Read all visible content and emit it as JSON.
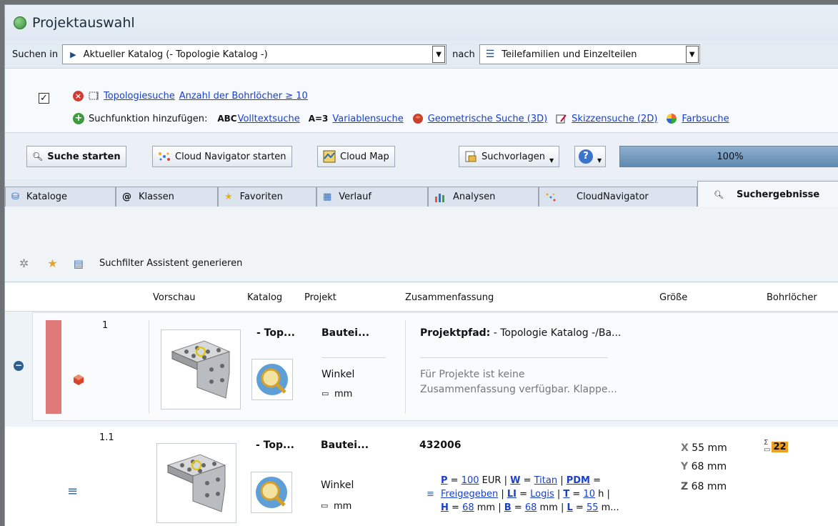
{
  "window": {
    "title": "Projektauswahl"
  },
  "search": {
    "search_in_label": "Suchen in",
    "catalog_value": "Aktueller Katalog (- Topologie Katalog -)",
    "nach_label": "nach",
    "type_value": "Teilefamilien und Einzelteilen"
  },
  "filter": {
    "topology_link": "Topologiesuche",
    "condition_link": "Anzahl der Bohrlöcher ≥ 10",
    "add_label": "Suchfunktion hinzufügen:",
    "options": [
      {
        "prefix": "ABC",
        "label": "Volltextsuche"
      },
      {
        "prefix": "A=3",
        "label": "Variablensuche"
      },
      {
        "prefix": "",
        "label": "Geometrische Suche (3D)"
      },
      {
        "prefix": "",
        "label": "Skizzensuche (2D)"
      },
      {
        "prefix": "",
        "label": "Farbsuche"
      }
    ]
  },
  "toolbar": {
    "start_search": "Suche starten",
    "cloud_navigator": "Cloud Navigator starten",
    "cloud_map": "Cloud Map",
    "templates": "Suchvorlagen",
    "progress_text": "100%",
    "progress": 1.0
  },
  "tabs": [
    {
      "label": "Kataloge",
      "icon": "catalogs-icon"
    },
    {
      "label": "Klassen",
      "icon": "at-icon"
    },
    {
      "label": "Favoriten",
      "icon": "star-icon"
    },
    {
      "label": "Verlauf",
      "icon": "calendar-icon"
    },
    {
      "label": "Analysen",
      "icon": "bar-chart-icon"
    },
    {
      "label": "CloudNavigator",
      "icon": "cloud-icon"
    },
    {
      "label": "Suchergebnisse",
      "icon": "search-icon",
      "active": true
    }
  ],
  "filterbar": {
    "wizard_label": "Suchfilter Assistent generieren"
  },
  "columns": {
    "vorschau": "Vorschau",
    "katalog": "Katalog",
    "projekt": "Projekt",
    "zusammenfassung": "Zusammenfassung",
    "groesse": "Größe",
    "bohrloecher": "Bohrlöcher"
  },
  "rows": [
    {
      "index": "1",
      "catalog": "- Top...",
      "project": "Bautei...",
      "project_sub": "Winkel",
      "unit": "mm",
      "summary_title_label": "Projektpfad:",
      "summary_title_value": " - Topologie Katalog -/Ba...",
      "summary_line1": "Für Projekte ist keine",
      "summary_line2": "Zusammenfassung verfügbar. Klappe..."
    },
    {
      "index": "1.1",
      "catalog": "- Top...",
      "project": "Bautei...",
      "project_sub": "Winkel",
      "unit": "mm",
      "summary_title": "432006",
      "summary_l1": {
        "p_key": "P",
        "p_val": "100",
        "p_unit": "EUR",
        "w_key": "W",
        "w_val": "Titan",
        "pdm_key": "PDM"
      },
      "summary_l2": {
        "pdm_val": "Freigegeben",
        "li_key": "LI",
        "li_val": "Logis",
        "t_key": "T",
        "t_val": "10",
        "t_unit": "h"
      },
      "summary_l3": {
        "h_key": "H",
        "h_val": "68",
        "b_key": "B",
        "b_val": "68",
        "l_key": "L",
        "l_val": "55",
        "tail": "m..."
      },
      "size_x": "55 mm",
      "size_y": "68 mm",
      "size_z": "68 mm",
      "holes": "22"
    }
  ],
  "colors": {
    "link": "#1a3fc9",
    "row_marker": "#e07a7a",
    "holes_badge": "#f0a020"
  }
}
